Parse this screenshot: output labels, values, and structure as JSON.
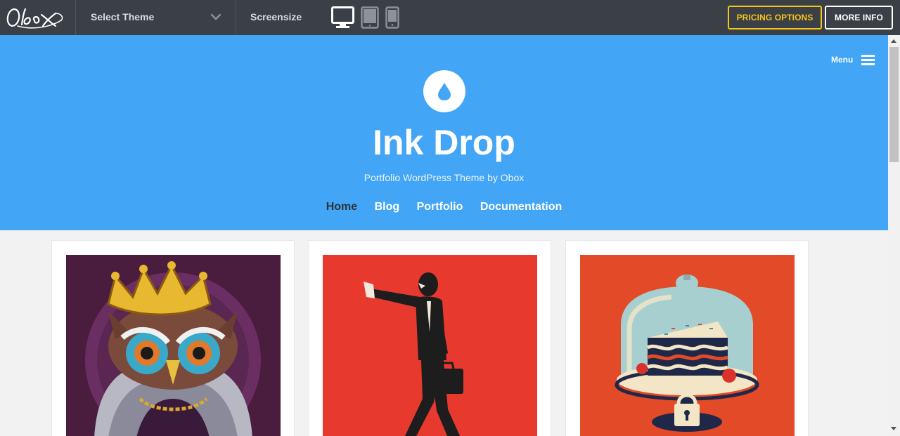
{
  "topbar": {
    "logo_text": "Obox",
    "theme_select_label": "Select Theme",
    "screensize_label": "Screensize",
    "devices": [
      "desktop-icon",
      "tablet-icon",
      "phone-icon"
    ],
    "pricing_label": "PRICING OPTIONS",
    "more_info_label": "MORE INFO",
    "colors": {
      "bar": "#3b3f46",
      "pricing_accent": "#f5c518"
    }
  },
  "site": {
    "menu_label": "Menu",
    "title": "Ink Drop",
    "tagline": "Portfolio WordPress Theme by Obox",
    "nav": [
      {
        "label": "Home",
        "active": true
      },
      {
        "label": "Blog",
        "active": false
      },
      {
        "label": "Portfolio",
        "active": false
      },
      {
        "label": "Documentation",
        "active": false
      }
    ],
    "colors": {
      "hero": "#42a5f5"
    }
  },
  "portfolio": [
    {
      "image": "owl-king-illustration"
    },
    {
      "image": "businessman-walking-illustration"
    },
    {
      "image": "cake-under-glass-illustration"
    }
  ]
}
